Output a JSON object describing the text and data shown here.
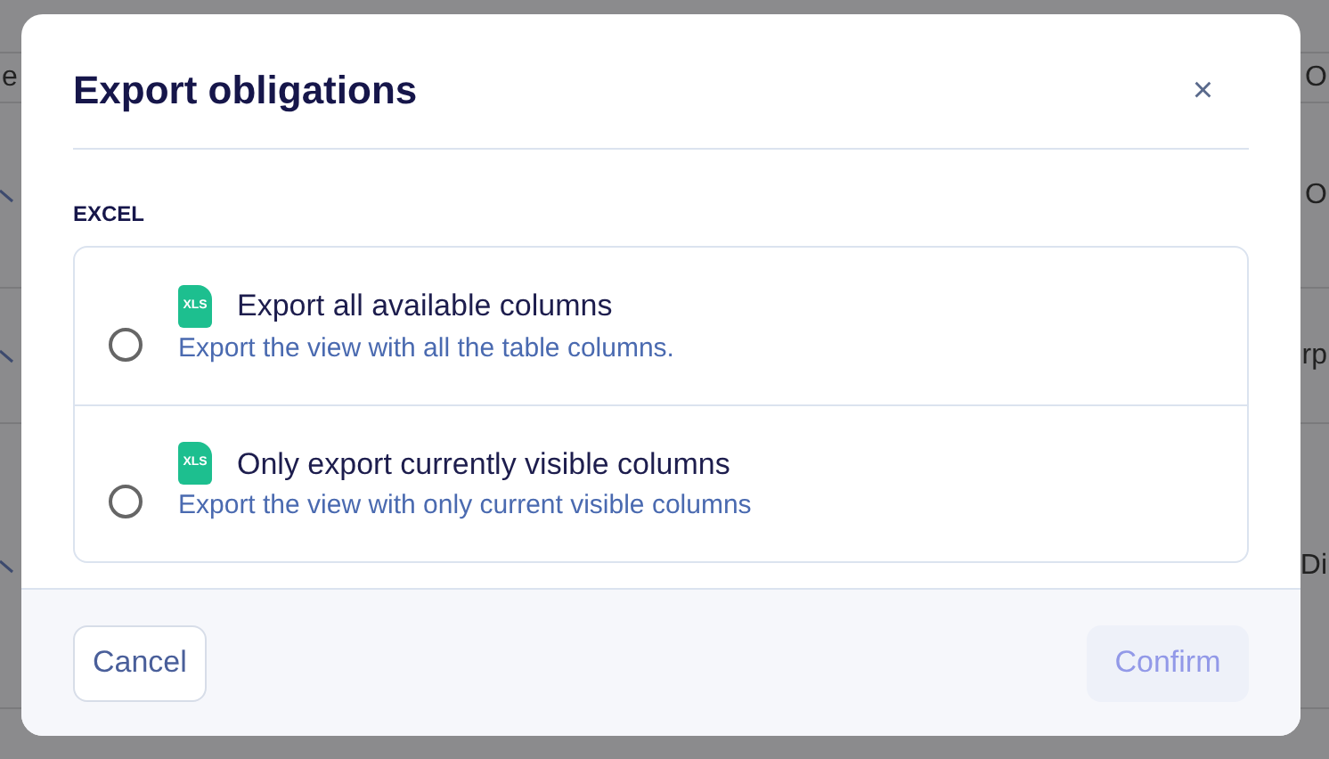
{
  "background_rows": [
    {
      "left": "e",
      "right": "O",
      "chevron": false
    },
    {
      "left": "",
      "right": "O",
      "chevron": true
    },
    {
      "left": "",
      "right": "rp",
      "chevron": true
    },
    {
      "left": "",
      "right": "Di",
      "chevron": true
    }
  ],
  "dialog": {
    "title": "Export obligations",
    "close": "×",
    "section": "EXCEL",
    "options": [
      {
        "title": "Export all available columns",
        "description": "Export the view with all the table columns.",
        "badge": "XLS",
        "selected": false
      },
      {
        "title": "Only export currently visible columns",
        "description": "Export the view with only current visible columns",
        "badge": "XLS",
        "selected": false
      }
    ],
    "cancel": "Cancel",
    "confirm": {
      "label": "Confirm",
      "disabled": true
    }
  }
}
